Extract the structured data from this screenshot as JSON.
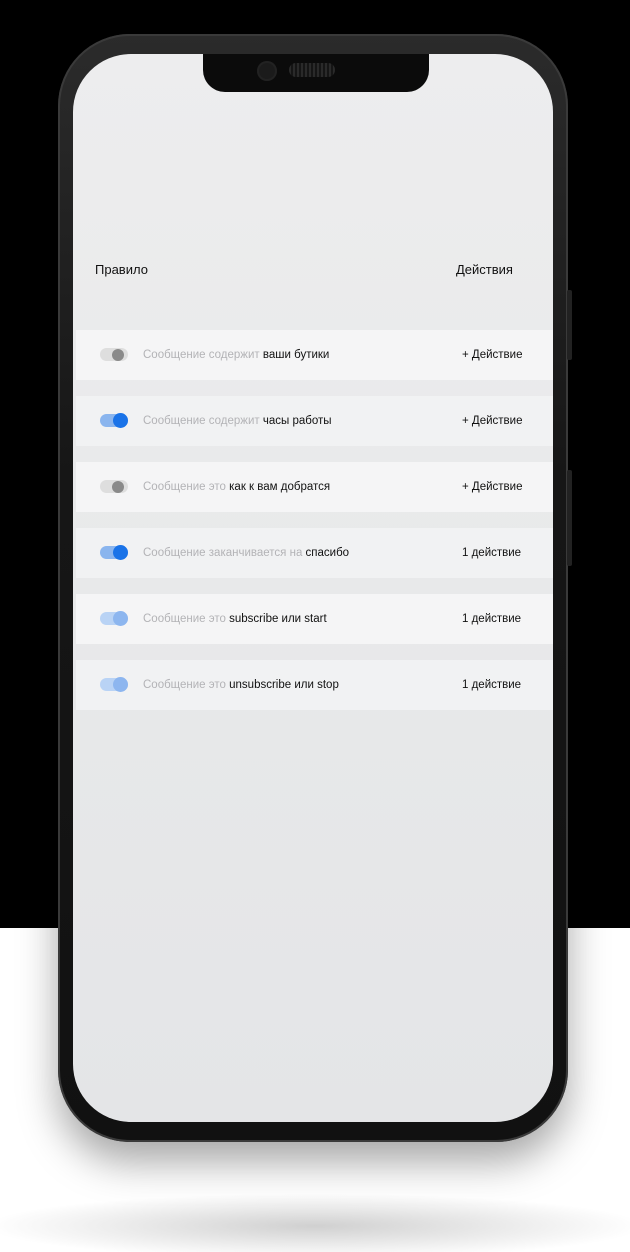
{
  "header": {
    "rule_label": "Правило",
    "actions_label": "Действия"
  },
  "rules": [
    {
      "enabled": false,
      "condition": "Сообщение содержит",
      "keyword": "ваши бутики",
      "action": "+ Действие"
    },
    {
      "enabled": true,
      "condition": "Сообщение содержит",
      "keyword": "часы работы",
      "action": "+ Действие"
    },
    {
      "enabled": false,
      "condition": "Сообщение это",
      "keyword": "как к вам добратся",
      "action": "+ Действие"
    },
    {
      "enabled": true,
      "condition": "Сообщение заканчивается на",
      "keyword": "спасибо",
      "action": "1 действие"
    },
    {
      "enabled": true,
      "condition": "Сообщение это",
      "keyword": "subscribe или start",
      "action": "1 действие"
    },
    {
      "enabled": true,
      "condition": "Сообщение это",
      "keyword": "unsubscribe или stop",
      "action": "1 действие"
    }
  ],
  "colors": {
    "accent": "#1a73e8",
    "accent_light": "#8db6ef",
    "screen_bg": "#e9eaeb"
  },
  "icons": {
    "camera": "front-camera-icon",
    "speaker": "earpiece-speaker-icon"
  }
}
